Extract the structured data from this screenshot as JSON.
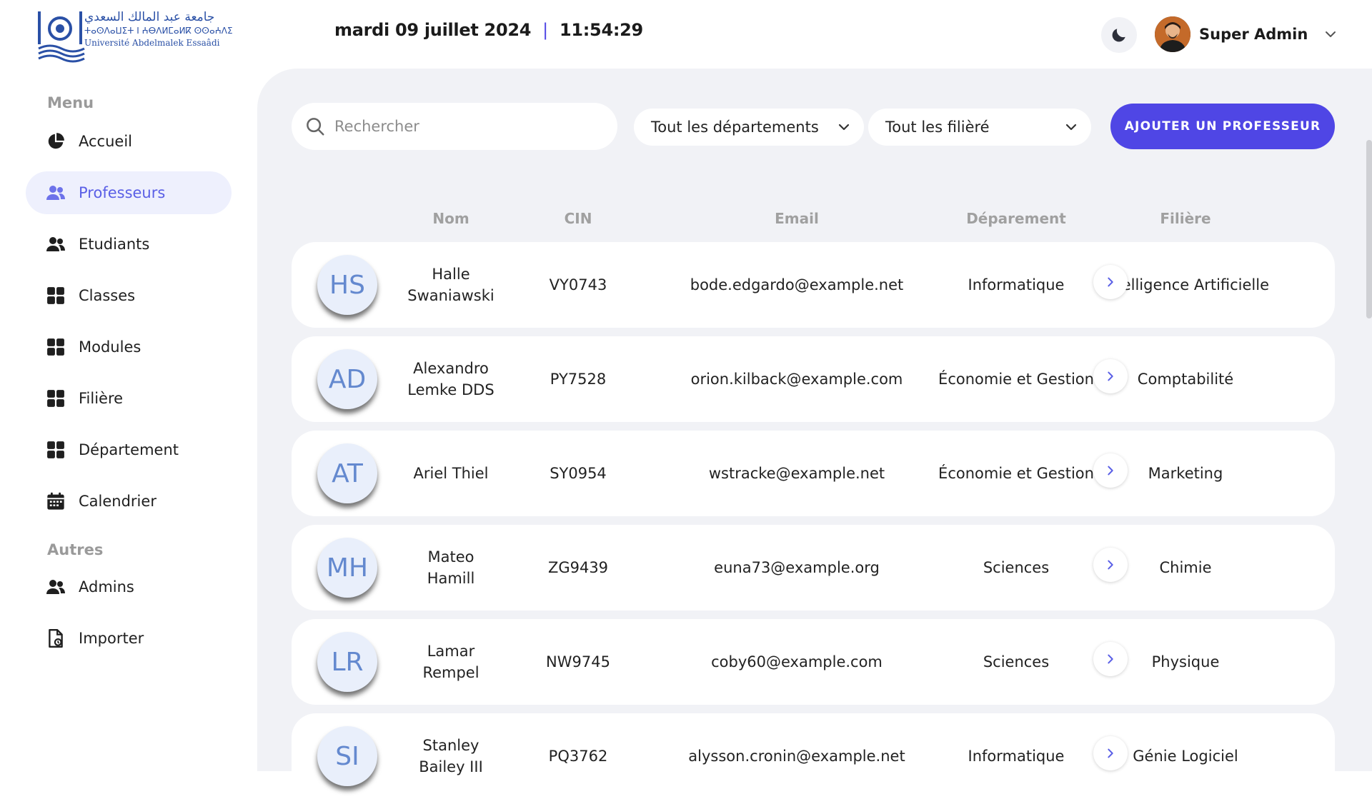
{
  "header": {
    "logo_arabic": "جامعة عبد المالك السعدي",
    "logo_tifinagh": "ⵜⴰⵙⴷⴰⵡⵉⵜ ⵏ ⵄⴱⴷⵍⵎⴰⵍⴽ ⵙⵙⴰⵄⴷⵉ",
    "logo_french": "Université Abdelmalek Essaâdi",
    "date": "mardi 09 juillet 2024",
    "separator": "|",
    "time": "11:54:29",
    "user_name": "Super Admin"
  },
  "sidebar": {
    "menu_title": "Menu",
    "others_title": "Autres",
    "items": [
      {
        "label": "Accueil",
        "icon": "pie-chart-icon"
      },
      {
        "label": "Professeurs",
        "icon": "users-icon",
        "active": true
      },
      {
        "label": "Etudiants",
        "icon": "users-icon"
      },
      {
        "label": "Classes",
        "icon": "grid-icon"
      },
      {
        "label": "Modules",
        "icon": "grid-icon"
      },
      {
        "label": "Filière",
        "icon": "grid-icon"
      },
      {
        "label": "Département",
        "icon": "grid-icon"
      },
      {
        "label": "Calendrier",
        "icon": "calendar-icon"
      }
    ],
    "other_items": [
      {
        "label": "Admins",
        "icon": "users-icon"
      },
      {
        "label": "Importer",
        "icon": "import-file-icon"
      }
    ]
  },
  "toolbar": {
    "search_placeholder": "Rechercher",
    "department_select": "Tout les départements",
    "filiere_select": "Tout les filièré",
    "add_button": "AJOUTER UN PROFESSEUR"
  },
  "table": {
    "headers": {
      "nom": "Nom",
      "cin": "CIN",
      "email": "Email",
      "departement": "Déparement",
      "filiere": "Filière"
    },
    "rows": [
      {
        "initials": "HS",
        "name": "Halle Swaniawski",
        "cin": "VY0743",
        "email": "bode.edgardo@example.net",
        "departement": "Informatique",
        "filiere": "Intelligence Artificielle"
      },
      {
        "initials": "AD",
        "name": "Alexandro Lemke DDS",
        "cin": "PY7528",
        "email": "orion.kilback@example.com",
        "departement": "Économie et Gestion",
        "filiere": "Comptabilité"
      },
      {
        "initials": "AT",
        "name": "Ariel Thiel",
        "cin": "SY0954",
        "email": "wstracke@example.net",
        "departement": "Économie et Gestion",
        "filiere": "Marketing"
      },
      {
        "initials": "MH",
        "name": "Mateo Hamill",
        "cin": "ZG9439",
        "email": "euna73@example.org",
        "departement": "Sciences",
        "filiere": "Chimie"
      },
      {
        "initials": "LR",
        "name": "Lamar Rempel",
        "cin": "NW9745",
        "email": "coby60@example.com",
        "departement": "Sciences",
        "filiere": "Physique"
      },
      {
        "initials": "SI",
        "name": "Stanley Bailey III",
        "cin": "PQ3762",
        "email": "alysson.cronin@example.net",
        "departement": "Informatique",
        "filiere": "Génie Logiciel"
      }
    ]
  },
  "colors": {
    "accent": "#4f46e5",
    "panel": "#f1f2f6",
    "avatar_bg": "#e9effb",
    "avatar_text": "#6489cf"
  }
}
